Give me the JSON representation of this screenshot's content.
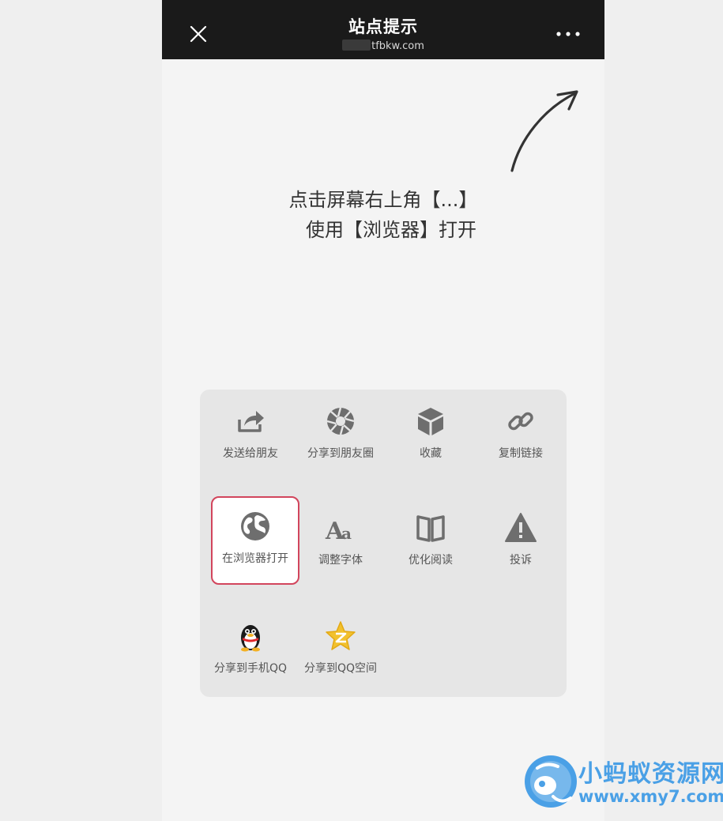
{
  "header": {
    "title": "站点提示",
    "domain": "tfbkw.com",
    "close_icon": "close-icon",
    "more_icon": "more-dots-icon"
  },
  "hint": {
    "line1": "点击屏幕右上角【...】",
    "line2": "使用【浏览器】打开"
  },
  "menu": {
    "items": [
      {
        "label": "发送给朋友",
        "icon": "share-forward-icon"
      },
      {
        "label": "分享到朋友圈",
        "icon": "moments-aperture-icon"
      },
      {
        "label": "收藏",
        "icon": "favorite-cube-icon"
      },
      {
        "label": "复制链接",
        "icon": "link-icon"
      },
      {
        "label": "在浏览器打开",
        "icon": "globe-icon",
        "highlighted": true
      },
      {
        "label": "调整字体",
        "icon": "font-size-icon",
        "glyph": "Aa"
      },
      {
        "label": "优化阅读",
        "icon": "book-icon"
      },
      {
        "label": "投诉",
        "icon": "warning-icon"
      },
      {
        "label": "分享到手机QQ",
        "icon": "qq-penguin-icon"
      },
      {
        "label": "分享到QQ空间",
        "icon": "qzone-star-icon"
      }
    ]
  },
  "watermark": {
    "name": "小蚂蚁资源网",
    "url": "www.xmy7.com"
  },
  "colors": {
    "header_bg": "#1a1a1a",
    "highlight_border": "#d2455c",
    "icon_gray": "#6e6e6e",
    "watermark_blue": "#4aa0e6"
  }
}
